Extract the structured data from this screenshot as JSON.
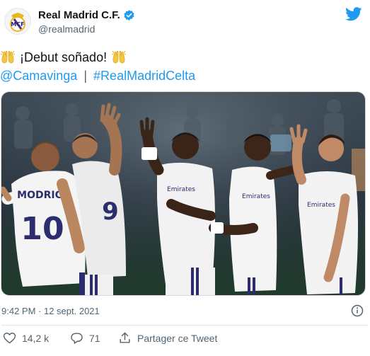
{
  "account": {
    "display_name": "Real Madrid C.F.",
    "handle": "@realmadrid"
  },
  "tweet": {
    "text": "¡Debut soñado!",
    "mention": "@Camavinga",
    "separator": "|",
    "hashtag": "#RealMadridCelta"
  },
  "media": {
    "player_numbers": [
      "10",
      "9"
    ],
    "player_names": [
      "MODRIC"
    ],
    "shirt_sponsor": "Emirates"
  },
  "meta": {
    "timestamp": "9:42 PM · 12 sept. 2021"
  },
  "actions": {
    "like_count": "14,2 k",
    "reply_count": "71",
    "share_label": "Partager ce Tweet"
  },
  "colors": {
    "accent": "#1d9bf0",
    "verified": "#1d9bf0",
    "secondary_text": "#536471",
    "text": "#0f1419"
  }
}
